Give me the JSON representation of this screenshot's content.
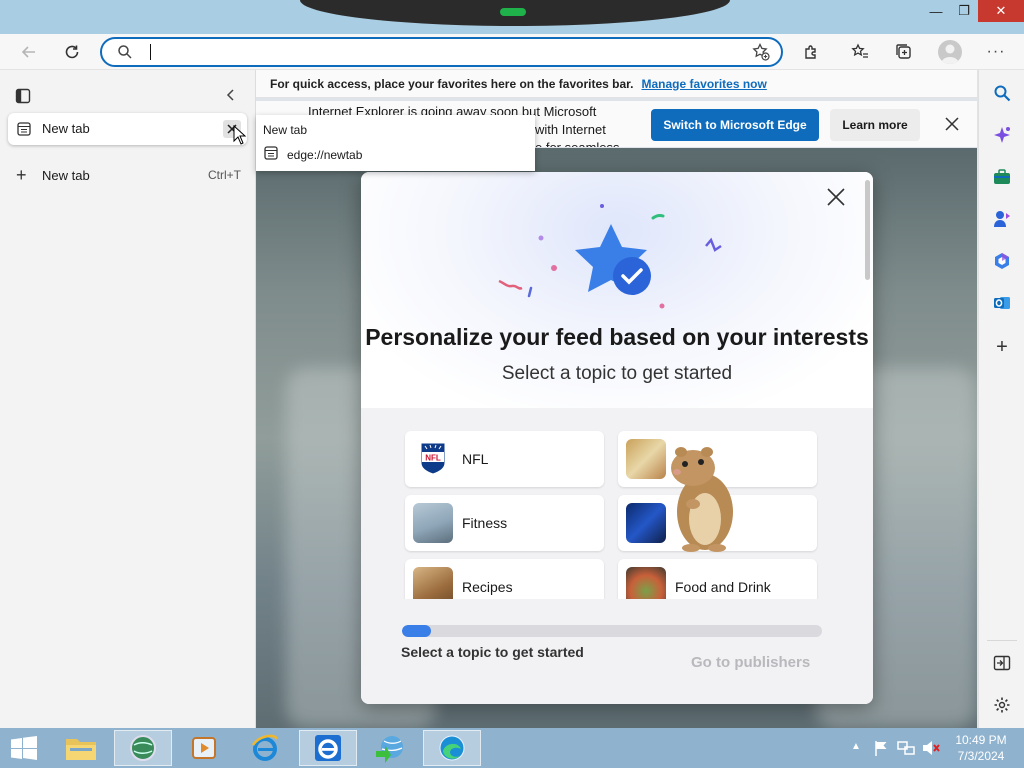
{
  "window": {
    "title_icons": [
      "minimize-icon",
      "restore-icon",
      "close-icon"
    ],
    "minimize": "—",
    "restore": "❐",
    "close": "✕"
  },
  "address": {
    "value": "",
    "placeholder": ""
  },
  "sidebar": {
    "tabs": [
      {
        "label": "New tab"
      }
    ],
    "new_tab": {
      "label": "New tab",
      "shortcut": "Ctrl+T"
    }
  },
  "tooltip": {
    "title": "New tab",
    "url": "edge://newtab"
  },
  "favbar": {
    "text": "For quick access, place your favorites here on the favorites bar.",
    "link": "Manage favorites now"
  },
  "infobar": {
    "line1": "Internet Explorer is going away soon but Microsoft",
    "line2": "with Internet",
    "line3": "e for seamless",
    "switch_label": "Switch to Microsoft Edge",
    "learn_label": "Learn more"
  },
  "modal": {
    "title": "Personalize your feed based on your interests",
    "subtitle": "Select a topic to get started",
    "topics": [
      {
        "label": "NFL"
      },
      {
        "label": ""
      },
      {
        "label": "Fitness"
      },
      {
        "label": ""
      },
      {
        "label": "Recipes"
      },
      {
        "label": "Food and Drink"
      }
    ],
    "progress_fraction": 0.07,
    "progress_label": "Select a topic to get started",
    "next_label": "Go to publishers"
  },
  "rail": {
    "icons": [
      "search-icon",
      "copilot-icon",
      "tools-icon",
      "games-icon",
      "office-icon",
      "outlook-icon",
      "add-icon"
    ]
  },
  "taskbar": {
    "time": "10:49 PM",
    "date": "7/3/2024"
  },
  "colors": {
    "accent": "#0f6cbd",
    "titlebar": "#a9cde2",
    "taskbar": "#8fb3ce",
    "close_red": "#c7382e"
  }
}
